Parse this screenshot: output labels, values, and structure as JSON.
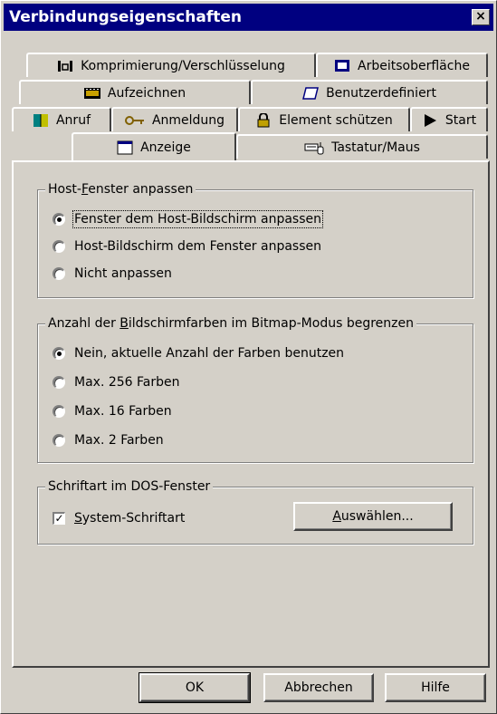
{
  "window": {
    "title": "Verbindungseigenschaften",
    "close_glyph": "×"
  },
  "tabs": {
    "row1": [
      {
        "label": "Komprimierung/Verschlüsselung",
        "icon": "compression-icon"
      },
      {
        "label": "Arbeitsoberfläche",
        "icon": "desktop-icon"
      }
    ],
    "row2": [
      {
        "label": "Aufzeichnen",
        "icon": "recording-icon"
      },
      {
        "label": "Benutzerdefiniert",
        "icon": "custom-icon"
      }
    ],
    "row3": [
      {
        "label": "Anruf",
        "icon": "phonebook-icon"
      },
      {
        "label": "Anmeldung",
        "icon": "key-icon"
      },
      {
        "label": "Element schützen",
        "icon": "lock-icon"
      },
      {
        "label": "Start",
        "icon": "play-icon"
      }
    ],
    "row4": [
      {
        "label": "Anzeige",
        "icon": "window-icon",
        "selected": true
      },
      {
        "label": "Tastatur/Maus",
        "icon": "keyboard-mouse-icon"
      }
    ]
  },
  "host_group": {
    "legend_pre": "Host-",
    "legend_ul": "F",
    "legend_post": "enster anpassen",
    "options": [
      {
        "label": "Fenster dem Host-Bildschirm anpassen",
        "checked": true
      },
      {
        "label": "Host-Bildschirm dem Fenster anpassen",
        "checked": false
      },
      {
        "label": "Nicht anpassen",
        "checked": false
      }
    ]
  },
  "colors_group": {
    "legend_pre": "Anzahl der ",
    "legend_ul": "B",
    "legend_post": "ildschirmfarben im Bitmap-Modus begrenzen",
    "options": [
      {
        "label": "Nein, aktuelle Anzahl der Farben benutzen",
        "checked": true
      },
      {
        "label": "Max. 256 Farben",
        "checked": false
      },
      {
        "label": "Max. 16 Farben",
        "checked": false
      },
      {
        "label": "Max. 2 Farben",
        "checked": false
      }
    ]
  },
  "font_group": {
    "legend": "Schriftart im DOS-Fenster",
    "checkbox_ul": "S",
    "checkbox_rest": "ystem-Schriftart",
    "checkbox_checked": true,
    "check_glyph": "✓",
    "choose_ul": "A",
    "choose_rest": "uswählen..."
  },
  "buttons": {
    "ok": "OK",
    "cancel": "Abbrechen",
    "help": "Hilfe"
  }
}
